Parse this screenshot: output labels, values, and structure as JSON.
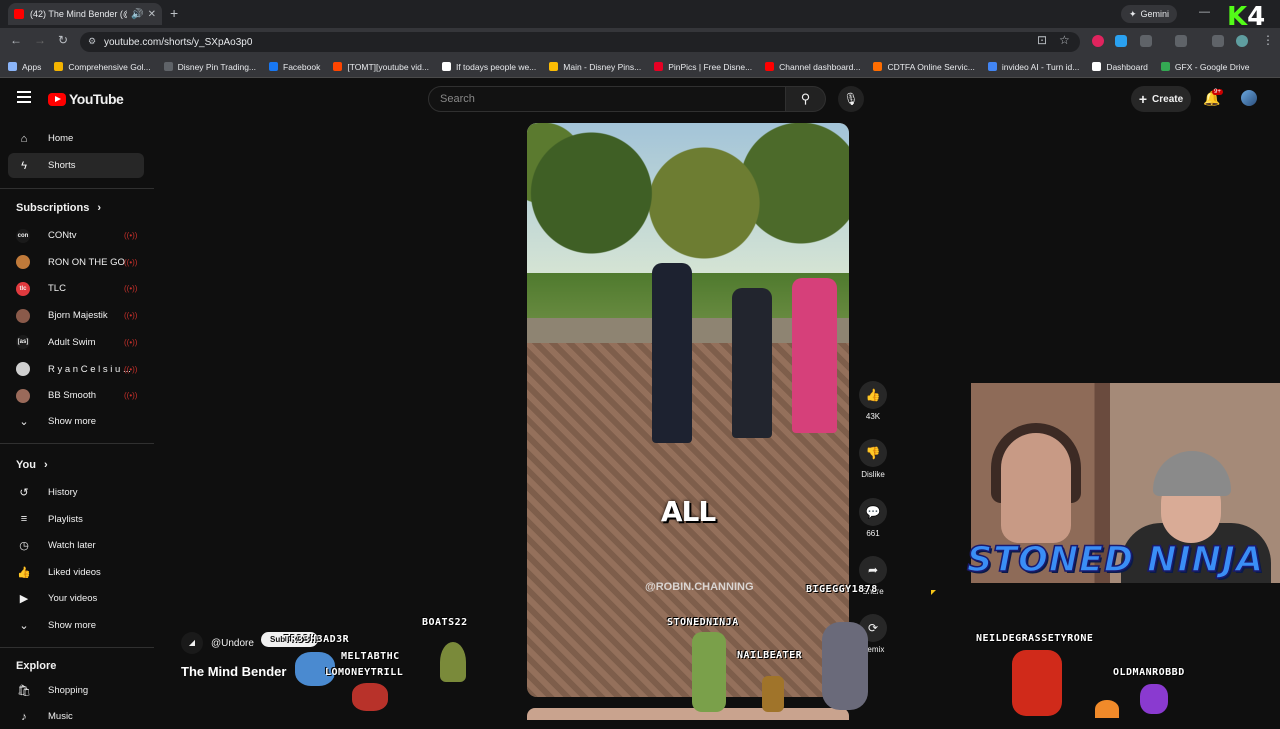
{
  "browser": {
    "tab_title": "(42) The Mind Bender (@ro",
    "url": "youtube.com/shorts/y_SXpAo3p0",
    "gemini_label": "Gemini",
    "bookmarks": [
      "Apps",
      "Comprehensive Gol...",
      "Disney Pin Trading...",
      "Facebook",
      "[TOMT][youtube vid...",
      "If todays people we...",
      "Main - Disney Pins...",
      "PinPics | Free Disne...",
      "Channel dashboard...",
      "CDTFA Online Servic...",
      "invideo AI - Turn id...",
      "Dashboard",
      "GFX - Google Drive"
    ],
    "bookmark_colors": [
      "#8ab4f8",
      "#f4b400",
      "#5f6368",
      "#1877f2",
      "#ff4500",
      "#ffffff",
      "#fbbc04",
      "#e60023",
      "#ff0000",
      "#ff6d00",
      "#4285f4",
      "#ffffff",
      "#34a853"
    ]
  },
  "overlay": {
    "logo_k": "K",
    "logo_num": "4",
    "stoned_ninja": "STONED NINJA",
    "chat_names": [
      "BOATS22",
      "TR33H3AD3R",
      "MELTABTHC",
      "LOMONEYTRILL",
      "STONEDNINJA",
      "NAILBEATER",
      "BIGEGGY1878",
      "NEILDEGRASSETYRONE",
      "OLDMANROBBD"
    ]
  },
  "header": {
    "logo_text": "YouTube",
    "search_placeholder": "Search",
    "create_label": "Create",
    "notification_badge": "9+"
  },
  "sidebar": {
    "home": "Home",
    "shorts": "Shorts",
    "subscriptions_title": "Subscriptions",
    "subscriptions": [
      {
        "name": "CONtv",
        "color": "#1a1a1a",
        "initial": "con"
      },
      {
        "name": "RON ON THE GO",
        "color": "#c07a3a",
        "initial": ""
      },
      {
        "name": "TLC",
        "color": "#e03a3e",
        "initial": "tlc"
      },
      {
        "name": "Bjorn Majestik",
        "color": "#8a5a4a",
        "initial": ""
      },
      {
        "name": "Adult Swim",
        "color": "#1a1a1a",
        "initial": "[as]"
      },
      {
        "name": "R y a n C e l s i u ...",
        "color": "#cfcfcf",
        "initial": ""
      },
      {
        "name": "BB Smooth",
        "color": "#9a6a5a",
        "initial": ""
      }
    ],
    "show_more_1": "Show more",
    "you_title": "You",
    "you_items": [
      "History",
      "Playlists",
      "Watch later",
      "Liked videos",
      "Your videos"
    ],
    "show_more_2": "Show more",
    "explore_title": "Explore",
    "explore_items": [
      "Shopping",
      "Music"
    ]
  },
  "short": {
    "caption": "ALL",
    "watermark": "@ROBIN.CHANNING",
    "channel_handle": "@Undore",
    "subscribe_label": "Subscribe",
    "title": "The Mind Bender",
    "likes": "43K",
    "dislike_label": "Dislike",
    "comments": "661",
    "share_label": "Share",
    "remix_label": "Remix"
  }
}
